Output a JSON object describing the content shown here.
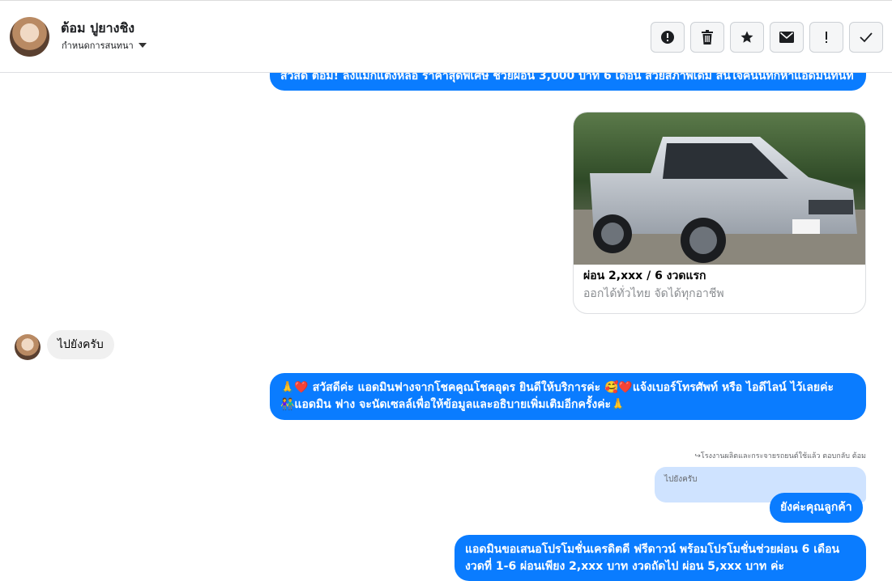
{
  "header": {
    "contact_name": "ต้อม ปูยางชิง",
    "subtitle": "กำหนดการสนทนา"
  },
  "toolbar": {
    "buttons": [
      {
        "icon": "alert-circle-icon"
      },
      {
        "icon": "trash-icon"
      },
      {
        "icon": "star-icon"
      },
      {
        "icon": "mail-icon"
      },
      {
        "icon": "exclamation-icon"
      },
      {
        "icon": "check-icon"
      }
    ]
  },
  "messages": {
    "m1_text": "สวัสดี ต้อม! ลงแม็กแต่งหล่อ ราคาสุดพิเศษ ช่วยผ่อน 3,000 บาท 6 เดือน สวยสภาพเดิม สนใจคนนี้ทักหาแอดมินทันที",
    "card_title": "ผ่อน 2,xxx / 6 งวดแรก",
    "card_subtitle": "ออกได้ทั่วไทย จัดได้ทุกอาชีพ",
    "in1_text": "ไปยังครับ",
    "m2_line1": "🙏❤️ สวัสดีค่ะ แอดมินฟางจากโชคคูณโชคอุดร ยินดีให้บริการค่ะ 🥰❤️แจ้งเบอร์โทรศัพท์ หรือ ไอดีไลน์ ไว้เลยค่ะ",
    "m2_line2": "👫แอดมิน ฟาง จะนัดเซลล์เพื่อให้ข้อมูลและอธิบายเพิ่มเติมอีกครั้งค่ะ🙏",
    "reply_meta": "↪โรงงานผลิตและกระจายรถยนต์ใช้แล้ว ตอบกลับ ต้อม",
    "quoted_text": "ไปยังครับ",
    "m3_text": "ยังค่ะคุณลูกค้า",
    "m4_text": "แอดมินขอเสนอโปรโมชั่นเครดิตดี ฟรีดาวน์ พร้อมโปรโมชั่นช่วยผ่อน 6 เดือน งวดที่ 1-6 ผ่อนเพียง 2,xxx บาท งวดถัดไป ผ่อน 5,xxx บาท ค่ะ"
  },
  "colors": {
    "outgoing_bubble": "#0a7cff",
    "incoming_bubble": "#f0f0f0",
    "quoted_bubble": "#cfe3ff"
  }
}
